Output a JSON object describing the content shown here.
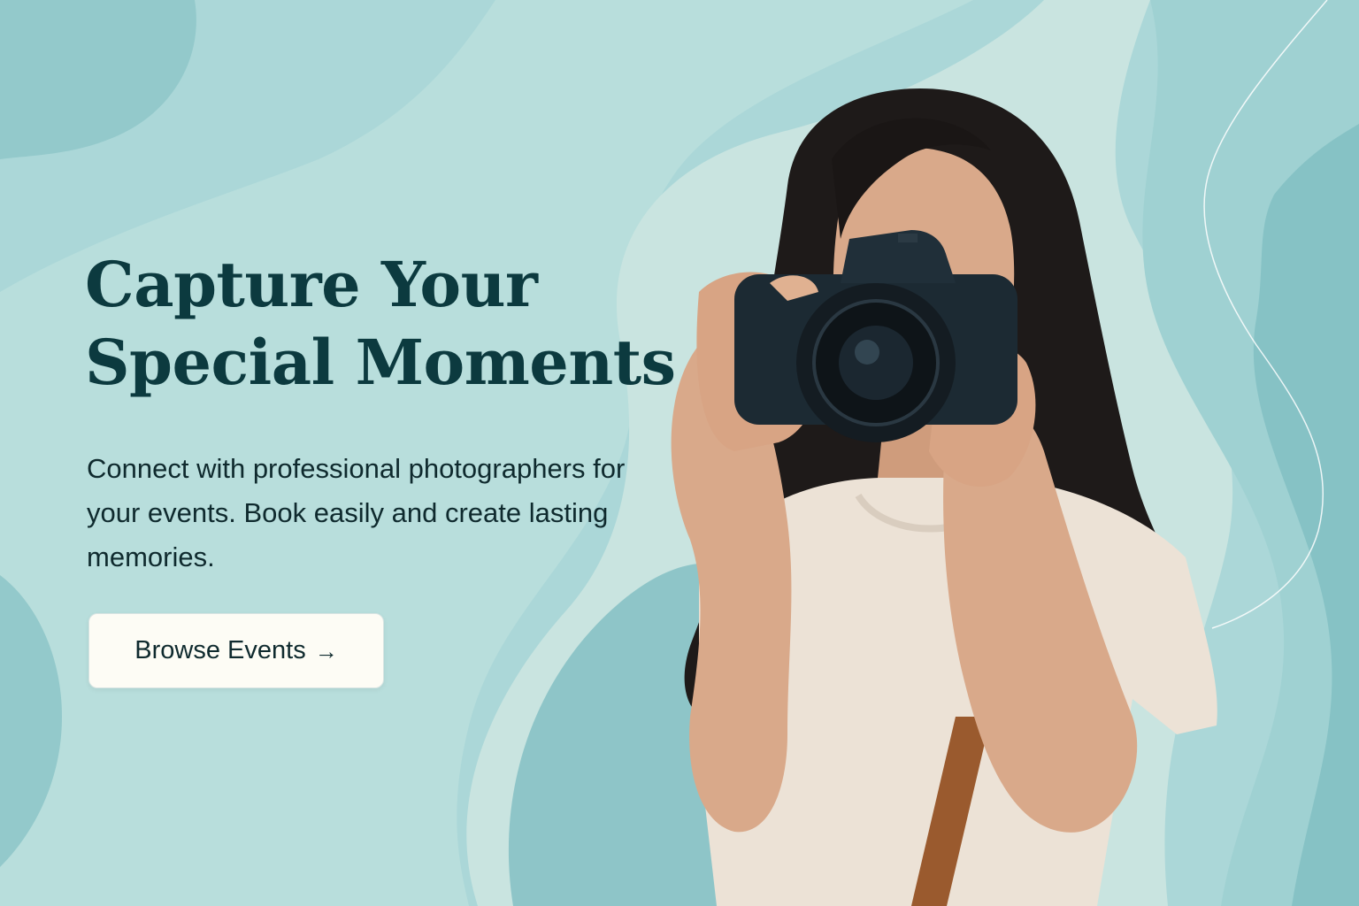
{
  "hero": {
    "headline_line1": "Capture Your",
    "headline_line2": "Special Moments",
    "subtext": "Connect with professional photographers for your events. Book easily and create lasting memories.",
    "cta_label": "Browse Events",
    "cta_icon": "arrow-right-icon",
    "cta_arrow": "→"
  },
  "colors": {
    "background": "#a9d6d7",
    "blob_dark": "#8cc6c8",
    "blob_light": "#c6e3e0",
    "headline": "#0c3a3f",
    "body_text": "#0f2a2e",
    "button_bg": "#fdfcf5"
  },
  "image": {
    "subject": "photographer-holding-camera"
  }
}
